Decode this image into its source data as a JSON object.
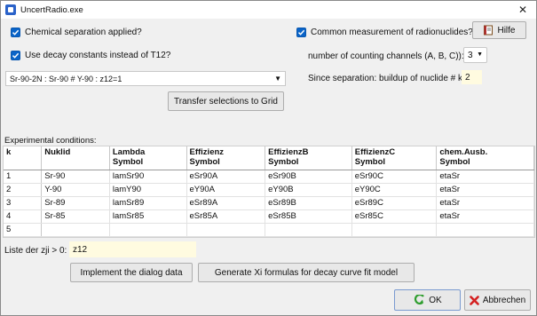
{
  "window": {
    "title": "UncertRadio.exe",
    "close_glyph": "✕"
  },
  "left": {
    "chem_sep": {
      "label": "Chemical separation applied?",
      "checked": true
    },
    "decay_const": {
      "label": "Use decay constants instead of T12?",
      "checked": true
    },
    "combo_value": "Sr-90-2N : Sr-90 # Y-90 : z12=1",
    "transfer_button": "Transfer selections to Grid"
  },
  "right": {
    "common_meas": {
      "label": "Common measurement of radionuclides?",
      "checked": true
    },
    "help_button": "Hilfe",
    "channels_label": "number of counting channels (A, B, C)):",
    "channels_value": "3",
    "buildup_label": "Since separation: buildup of nuclide # k:",
    "buildup_value": "2"
  },
  "grid": {
    "caption": "Experimental conditions:",
    "headers": [
      {
        "line1": "k",
        "line2": ""
      },
      {
        "line1": "Nuklid",
        "line2": ""
      },
      {
        "line1": "Lambda",
        "line2": "Symbol"
      },
      {
        "line1": "Effizienz",
        "line2": "Symbol"
      },
      {
        "line1": "EffizienzB",
        "line2": "Symbol"
      },
      {
        "line1": "EffizienzC",
        "line2": "Symbol"
      },
      {
        "line1": "chem.Ausb.",
        "line2": "Symbol"
      }
    ],
    "rows": [
      [
        "1",
        "Sr-90",
        "lamSr90",
        "eSr90A",
        "eSr90B",
        "eSr90C",
        "etaSr"
      ],
      [
        "2",
        "Y-90",
        "lamY90",
        "eY90A",
        "eY90B",
        "eY90C",
        "etaSr"
      ],
      [
        "3",
        "Sr-89",
        "lamSr89",
        "eSr89A",
        "eSr89B",
        "eSr89C",
        "etaSr"
      ],
      [
        "4",
        "Sr-85",
        "lamSr85",
        "eSr85A",
        "eSr85B",
        "eSr85C",
        "etaSr"
      ],
      [
        "5",
        "",
        "",
        "",
        "",
        "",
        ""
      ]
    ]
  },
  "zji": {
    "label": "Liste der zji > 0:",
    "value": "z12"
  },
  "buttons": {
    "implement": "Implement the dialog data",
    "generate": "Generate Xi formulas for decay curve fit model",
    "ok": "OK",
    "cancel": "Abbrechen"
  },
  "colors": {
    "accent": "#0a64c8",
    "ok_green": "#2e9e2e",
    "cancel_red": "#d42020",
    "value_bg": "#fffbe0"
  }
}
